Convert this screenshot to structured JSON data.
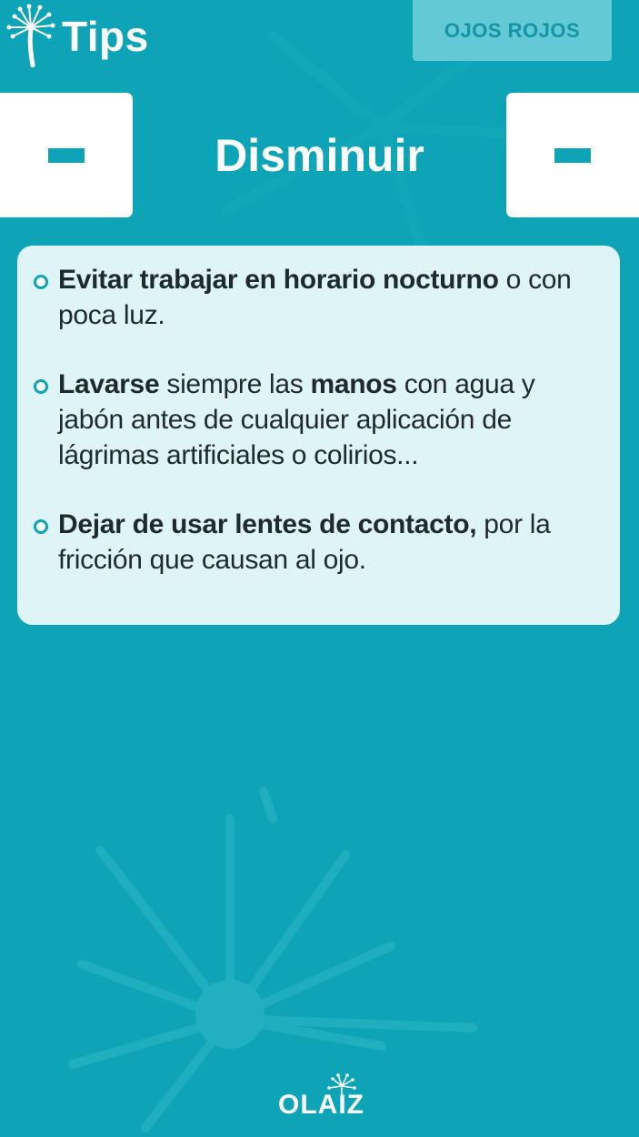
{
  "header": {
    "title": "Tips",
    "category_button": "OJOS ROJOS"
  },
  "section": {
    "title": "Disminuir"
  },
  "tips": [
    {
      "parts": [
        {
          "bold": "Evitar trabajar en horario nocturno"
        },
        {
          "text": " o con poca luz."
        }
      ]
    },
    {
      "parts": [
        {
          "bold": "Lavarse"
        },
        {
          "text": " siempre las "
        },
        {
          "bold": "manos"
        },
        {
          "text": " con agua y jabón antes de cualquier aplicación de lágrimas artificiales o colirios..."
        }
      ]
    },
    {
      "parts": [
        {
          "bold": "Dejar de usar lentes de contacto,"
        },
        {
          "text": " por la fricción que causan al ojo."
        }
      ]
    }
  ],
  "footer": {
    "brand": "OLAIZ"
  },
  "colors": {
    "background": "#0ca4b6",
    "button_light": "#62c9d5",
    "card": "#f0fafb",
    "text": "#1f2a2d"
  },
  "icons": {
    "app_logo": "dandelion-icon",
    "nav": "minus-icon",
    "bullet": "circle-bullet-icon"
  }
}
